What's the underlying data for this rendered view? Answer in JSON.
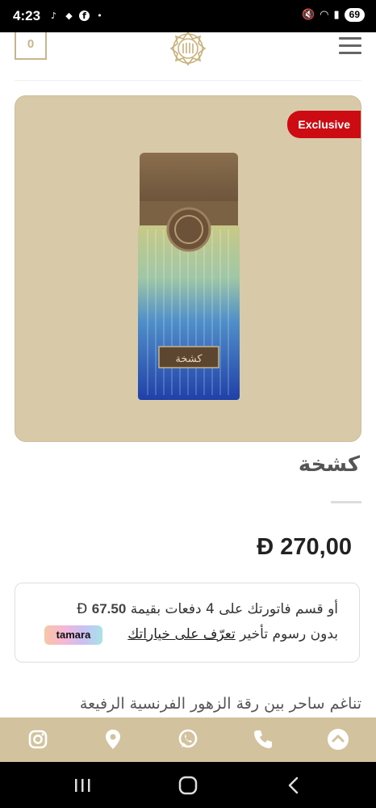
{
  "status_bar": {
    "time": "4:23",
    "battery": "69"
  },
  "header": {
    "cart_count": "0"
  },
  "product": {
    "badge": "Exclusive",
    "bottle_label": "كشخة",
    "title": "كشخة",
    "currency_symbol": "Đ",
    "price": "270,00"
  },
  "tamara": {
    "line1_prefix": "أو قسم فاتورتك على 4 دفعات بقيمة",
    "installment": "67.50",
    "line2_text": "بدون رسوم تأخير",
    "learn_more": "تعرّف على خياراتك",
    "logo_text": "tamara"
  },
  "description": {
    "text": "تناغم ساحر بين رقة الزهور الفرنسية الرفيعة"
  },
  "bottom_bar": {
    "items": [
      "instagram-icon",
      "location-pin-icon",
      "whatsapp-icon",
      "phone-icon",
      "scroll-up-icon"
    ]
  },
  "colors": {
    "accent": "#d2c29e",
    "badge": "#cc0b12",
    "image_bg": "#d8c9a8"
  }
}
